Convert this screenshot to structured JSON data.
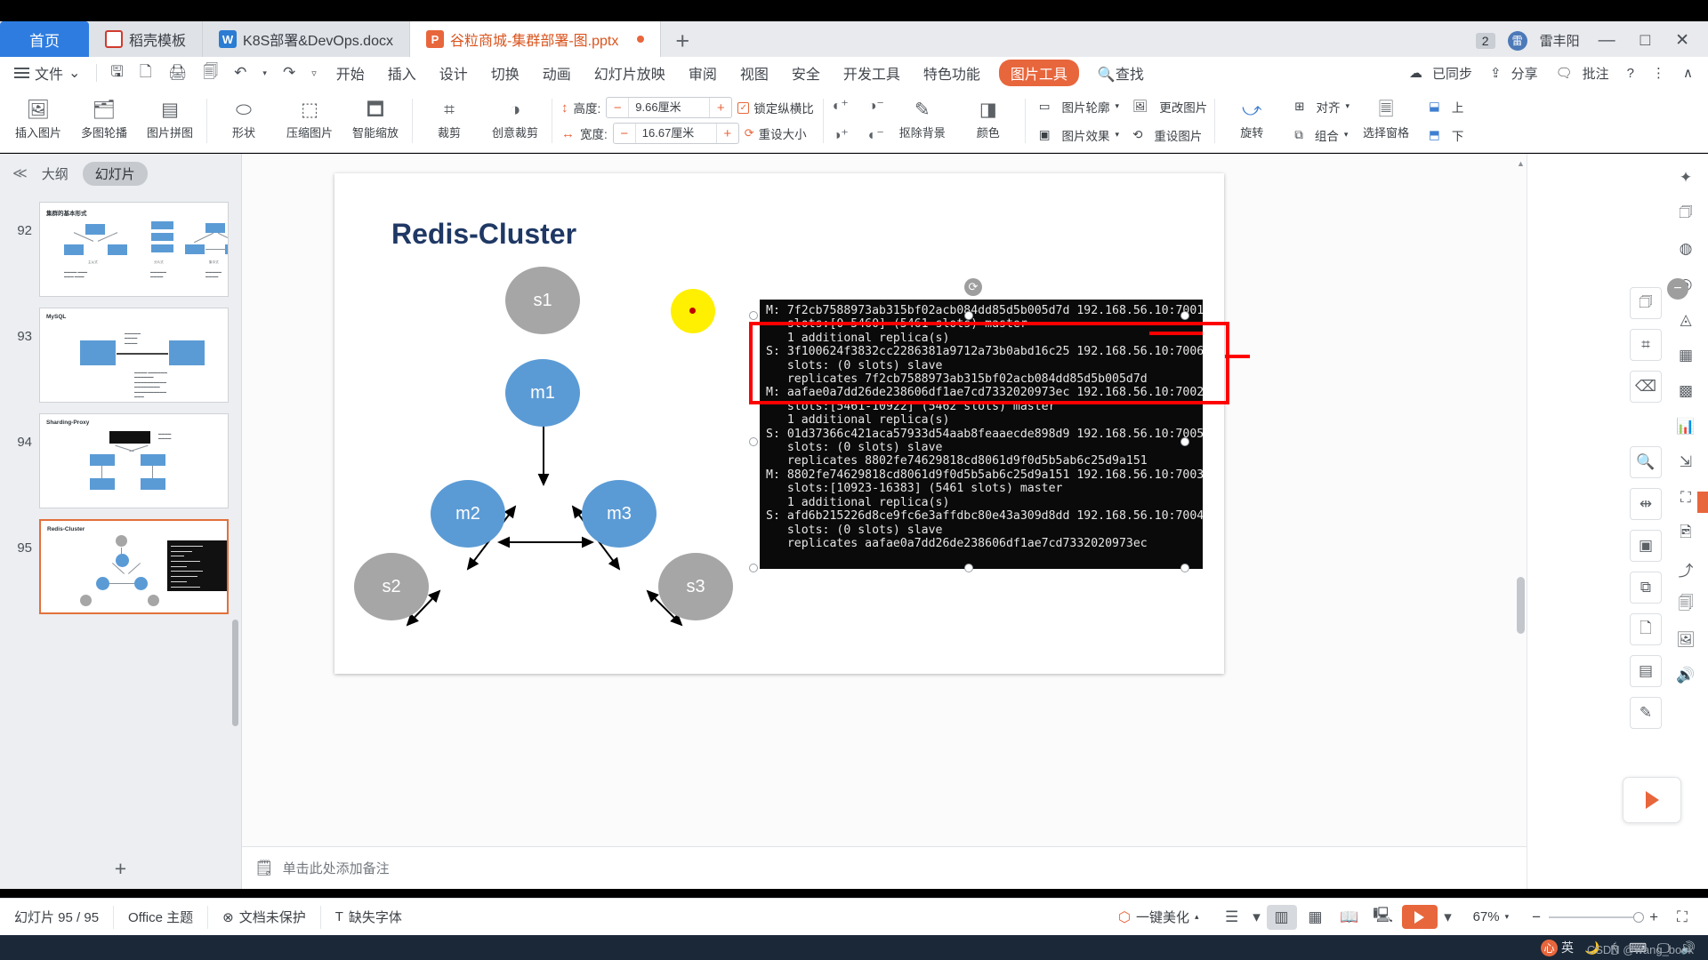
{
  "window": {
    "tabs": [
      {
        "label": "首页",
        "type": "home"
      },
      {
        "label": "稻壳模板",
        "icon": "docer-icon",
        "type": "docer"
      },
      {
        "label": "K8S部署&DevOps.docx",
        "icon": "word-icon",
        "type": "word"
      },
      {
        "label": "谷粒商城-集群部署-图.pptx",
        "icon": "ppt-icon",
        "type": "ppt",
        "active": true
      }
    ],
    "new_tab_label": "+",
    "badge_count": "2",
    "user_name": "雷丰阳",
    "minimize": "—",
    "maximize": "□",
    "close": "✕"
  },
  "menubar": {
    "file_label": "文件",
    "file_caret": "⌄",
    "quick_icons": [
      "save-icon",
      "save-as-icon",
      "print-icon",
      "print-preview-icon",
      "undo-icon",
      "redo-icon",
      "customize-icon"
    ],
    "items": [
      "开始",
      "插入",
      "设计",
      "切换",
      "动画",
      "幻灯片放映",
      "审阅",
      "视图",
      "安全",
      "开发工具",
      "特色功能"
    ],
    "active_pill": "图片工具",
    "search_label": "查找",
    "right_items": [
      {
        "label": "已同步",
        "icon": "cloud-sync-icon"
      },
      {
        "label": "分享",
        "icon": "share-icon"
      },
      {
        "label": "批注",
        "icon": "comment-icon"
      },
      {
        "label": "?",
        "icon": "help-icon"
      },
      {
        "label": "⋮",
        "icon": "more-icon"
      },
      {
        "label": "∧",
        "icon": "collapse-ribbon-icon"
      }
    ]
  },
  "ribbon": {
    "buttons": [
      {
        "label": "插入图片",
        "icon": "insert-picture-icon",
        "caret": true
      },
      {
        "label": "多图轮播",
        "icon": "carousel-icon",
        "caret": true
      },
      {
        "label": "图片拼图",
        "icon": "collage-icon",
        "caret": true
      },
      {
        "label": "形状",
        "icon": "shape-icon",
        "caret": true
      },
      {
        "label": "压缩图片",
        "icon": "compress-icon",
        "caret": false
      },
      {
        "label": "智能缩放",
        "icon": "smart-scale-icon",
        "caret": false
      },
      {
        "label": "裁剪",
        "icon": "crop-icon",
        "caret": true
      },
      {
        "label": "创意裁剪",
        "icon": "creative-crop-icon",
        "caret": true
      }
    ],
    "height_label": "高度:",
    "height_value": "9.66厘米",
    "width_label": "宽度:",
    "width_value": "16.67厘米",
    "lock_ratio_label": "锁定纵横比",
    "reset_size_label": "重设大小",
    "minus": "−",
    "plus": "+",
    "tools": [
      {
        "label": "抠除背景",
        "icon": "remove-background-icon",
        "caret": true
      },
      {
        "label": "颜色",
        "icon": "color-icon",
        "caret": true
      },
      {
        "label": "图片轮廓",
        "icon": "picture-outline-icon",
        "caret": true
      },
      {
        "label": "图片效果",
        "icon": "picture-effects-icon",
        "caret": true
      },
      {
        "label": "更改图片",
        "icon": "change-picture-icon",
        "caret": false
      },
      {
        "label": "重设图片",
        "icon": "reset-picture-icon",
        "caret": false
      },
      {
        "label": "旋转",
        "icon": "rotate-icon",
        "caret": true
      },
      {
        "label": "对齐",
        "icon": "align-icon",
        "caret": true
      },
      {
        "label": "组合",
        "icon": "group-icon",
        "caret": true
      },
      {
        "label": "选择窗格",
        "icon": "selection-pane-icon",
        "caret": false
      }
    ],
    "corner_items": [
      {
        "label": "上",
        "icon": "bring-forward-icon"
      },
      {
        "label": "下",
        "icon": "send-backward-icon"
      }
    ]
  },
  "left_panel": {
    "collapse_icon": "chevron-double-left-icon",
    "tab_outline": "大纲",
    "tab_slides": "幻灯片",
    "add_slide": "+",
    "slides": [
      {
        "number": "92",
        "title": "集群的基本形式",
        "captions": [
          "主从式",
          "分片式",
          "集中式"
        ],
        "type": "diagram3"
      },
      {
        "number": "93",
        "title": "MySQL",
        "type": "diagram2"
      },
      {
        "number": "94",
        "title": "Sharding-Proxy",
        "type": "diagram4"
      },
      {
        "number": "95",
        "title": "Redis-Cluster",
        "type": "redis",
        "current": true
      }
    ]
  },
  "slide": {
    "title": "Redis-Cluster",
    "nodes": [
      {
        "id": "s1",
        "label": "s1",
        "color": "gray"
      },
      {
        "id": "m1",
        "label": "m1",
        "color": "blue"
      },
      {
        "id": "m2",
        "label": "m2",
        "color": "blue"
      },
      {
        "id": "m3",
        "label": "m3",
        "color": "blue"
      },
      {
        "id": "s2",
        "label": "s2",
        "color": "gray"
      },
      {
        "id": "s3",
        "label": "s3",
        "color": "gray"
      }
    ],
    "terminal_lines": [
      "M: 7f2cb7588973ab315bf02acb084dd85d5b005d7d 192.168.56.10:7001",
      "   slots:[0-5460] (5461 slots) master",
      "   1 additional replica(s)",
      "S: 3f100624f3832cc2286381a9712a73b0abd16c25 192.168.56.10:7006",
      "   slots: (0 slots) slave",
      "   replicates 7f2cb7588973ab315bf02acb084dd85d5b005d7d",
      "M: aafae0a7dd26de238606df1ae7cd7332020973ec 192.168.56.10:7002",
      "   slots:[5461-10922] (5462 slots) master",
      "   1 additional replica(s)",
      "S: 01d37366c421aca57933d54aab8feaaecde898d9 192.168.56.10:7005",
      "   slots: (0 slots) slave",
      "   replicates 8802fe74629818cd8061d9f0d5b5ab6c25d9a151",
      "M: 8802fe74629818cd8061d9f0d5b5ab6c25d9a151 192.168.56.10:7003",
      "   slots:[10923-16383] (5461 slots) master",
      "   1 additional replica(s)",
      "S: afd6b215226d8ce9fc6e3affdbc80e43a309d8dd 192.168.56.10:7004",
      "   slots: (0 slots) slave",
      "   replicates aafae0a7dd26de238606df1ae7cd7332020973ec"
    ]
  },
  "notes": {
    "icon": "notes-icon",
    "placeholder": "单击此处添加备注"
  },
  "status": {
    "slide_counter": "幻灯片 95 / 95",
    "theme": "Office 主题",
    "protection": "文档未保护",
    "missing_font": "缺失字体",
    "beautify": "一键美化",
    "view_buttons": [
      "outline-view-icon",
      "normal-view-icon",
      "slide-sorter-icon",
      "reading-view-icon",
      "presenter-view-icon"
    ],
    "play_label": "play-icon",
    "zoom_level": "67%",
    "zoom_minus": "−",
    "zoom_plus": "+"
  },
  "tray": {
    "ime_label": "英",
    "icons": [
      "moon-icon",
      "mouse-icon",
      "keyboard-icon",
      "monitor-icon",
      "volume-icon"
    ],
    "watermark": "CSDN @wang_book"
  },
  "colors": {
    "accent": "#e8663c",
    "tab_home": "#2e7ce0",
    "node_blue": "#5b9bd5",
    "node_gray": "#a6a6a6",
    "highlight_red": "#ff0000",
    "title_navy": "#1f3864",
    "yellow": "#ffef00"
  }
}
